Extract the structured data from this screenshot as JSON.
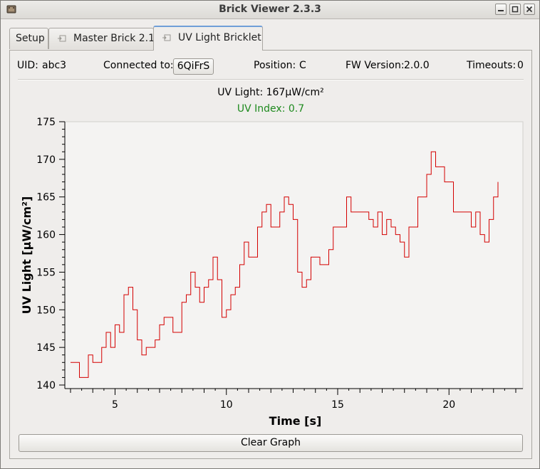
{
  "window": {
    "title": "Brick Viewer 2.3.3",
    "icons": [
      "brick-app-icon",
      "minimize-icon",
      "maximize-icon",
      "close-icon"
    ]
  },
  "tabs": [
    {
      "label": "Setup",
      "icon": null,
      "active": false
    },
    {
      "label": "Master Brick 2.1",
      "icon": "device-plug-icon",
      "active": false
    },
    {
      "label": "UV Light Bricklet",
      "icon": "device-plug-icon",
      "active": true
    }
  ],
  "info": {
    "uid_label": "UID:",
    "uid_value": "abc3",
    "connected_label": "Connected to:",
    "connected_value": "6QiFrS",
    "position_label": "Position:",
    "position_value": "C",
    "fw_label": "FW Version:",
    "fw_value": "2.0.0",
    "timeouts_label": "Timeouts:",
    "timeouts_value": "0"
  },
  "readings": {
    "uv_light": "UV Light: 167µW/cm²",
    "uv_index": "UV Index: 0.7",
    "uv_index_color": "#1e8a1e"
  },
  "chart_data": {
    "type": "line",
    "xlabel": "Time [s]",
    "ylabel": "UV Light [µW/cm²]",
    "xlim": [
      3,
      23
    ],
    "ylim": [
      140,
      175
    ],
    "xticks": [
      5,
      10,
      15,
      20
    ],
    "yticks": [
      140,
      145,
      150,
      155,
      160,
      165,
      170,
      175
    ],
    "line_color": "#d40000",
    "grid": false,
    "series": [
      {
        "x": [
          3.0,
          3.2,
          3.4,
          3.6,
          3.8,
          4.0,
          4.2,
          4.4,
          4.6,
          4.8,
          5.0,
          5.2,
          5.4,
          5.6,
          5.8,
          6.0,
          6.2,
          6.4,
          6.6,
          6.8,
          7.0,
          7.2,
          7.4,
          7.6,
          7.8,
          8.0,
          8.2,
          8.4,
          8.6,
          8.8,
          9.0,
          9.2,
          9.4,
          9.6,
          9.8,
          10.0,
          10.2,
          10.4,
          10.6,
          10.8,
          11.0,
          11.2,
          11.4,
          11.6,
          11.8,
          12.0,
          12.2,
          12.4,
          12.6,
          12.8,
          13.0,
          13.2,
          13.4,
          13.6,
          13.8,
          14.0,
          14.2,
          14.4,
          14.6,
          14.8,
          15.0,
          15.2,
          15.4,
          15.6,
          15.8,
          16.0,
          16.2,
          16.4,
          16.6,
          16.8,
          17.0,
          17.2,
          17.4,
          17.6,
          17.8,
          18.0,
          18.2,
          18.4,
          18.6,
          18.8,
          19.0,
          19.2,
          19.4,
          19.6,
          19.8,
          20.0,
          20.2,
          20.4,
          20.6,
          20.8,
          21.0,
          21.2,
          21.4,
          21.6,
          21.8,
          22.0,
          22.2
        ],
        "y": [
          143,
          143,
          141,
          141,
          144,
          143,
          143,
          145,
          147,
          145,
          148,
          147,
          152,
          153,
          150,
          146,
          144,
          145,
          145,
          146,
          148,
          149,
          149,
          147,
          147,
          151,
          152,
          155,
          153,
          151,
          153,
          154,
          157,
          154,
          149,
          150,
          152,
          153,
          156,
          159,
          157,
          157,
          161,
          163,
          164,
          161,
          161,
          163,
          165,
          164,
          162,
          155,
          153,
          154,
          157,
          157,
          156,
          156,
          158,
          161,
          161,
          161,
          165,
          163,
          163,
          163,
          163,
          162,
          161,
          163,
          160,
          162,
          161,
          160,
          159,
          157,
          161,
          161,
          165,
          165,
          168,
          171,
          169,
          169,
          167,
          167,
          163,
          163,
          163,
          163,
          161,
          163,
          160,
          159,
          162,
          165,
          167
        ]
      }
    ]
  },
  "buttons": {
    "clear_graph": "Clear Graph"
  }
}
